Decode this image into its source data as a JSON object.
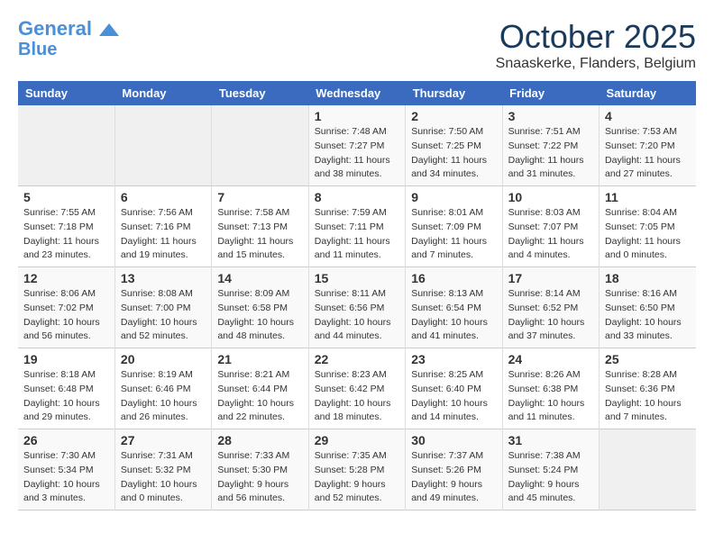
{
  "header": {
    "logo_line1": "General",
    "logo_line2": "Blue",
    "month": "October 2025",
    "location": "Snaaskerke, Flanders, Belgium"
  },
  "days_of_week": [
    "Sunday",
    "Monday",
    "Tuesday",
    "Wednesday",
    "Thursday",
    "Friday",
    "Saturday"
  ],
  "weeks": [
    [
      {
        "day": "",
        "info": ""
      },
      {
        "day": "",
        "info": ""
      },
      {
        "day": "",
        "info": ""
      },
      {
        "day": "1",
        "info": "Sunrise: 7:48 AM\nSunset: 7:27 PM\nDaylight: 11 hours\nand 38 minutes."
      },
      {
        "day": "2",
        "info": "Sunrise: 7:50 AM\nSunset: 7:25 PM\nDaylight: 11 hours\nand 34 minutes."
      },
      {
        "day": "3",
        "info": "Sunrise: 7:51 AM\nSunset: 7:22 PM\nDaylight: 11 hours\nand 31 minutes."
      },
      {
        "day": "4",
        "info": "Sunrise: 7:53 AM\nSunset: 7:20 PM\nDaylight: 11 hours\nand 27 minutes."
      }
    ],
    [
      {
        "day": "5",
        "info": "Sunrise: 7:55 AM\nSunset: 7:18 PM\nDaylight: 11 hours\nand 23 minutes."
      },
      {
        "day": "6",
        "info": "Sunrise: 7:56 AM\nSunset: 7:16 PM\nDaylight: 11 hours\nand 19 minutes."
      },
      {
        "day": "7",
        "info": "Sunrise: 7:58 AM\nSunset: 7:13 PM\nDaylight: 11 hours\nand 15 minutes."
      },
      {
        "day": "8",
        "info": "Sunrise: 7:59 AM\nSunset: 7:11 PM\nDaylight: 11 hours\nand 11 minutes."
      },
      {
        "day": "9",
        "info": "Sunrise: 8:01 AM\nSunset: 7:09 PM\nDaylight: 11 hours\nand 7 minutes."
      },
      {
        "day": "10",
        "info": "Sunrise: 8:03 AM\nSunset: 7:07 PM\nDaylight: 11 hours\nand 4 minutes."
      },
      {
        "day": "11",
        "info": "Sunrise: 8:04 AM\nSunset: 7:05 PM\nDaylight: 11 hours\nand 0 minutes."
      }
    ],
    [
      {
        "day": "12",
        "info": "Sunrise: 8:06 AM\nSunset: 7:02 PM\nDaylight: 10 hours\nand 56 minutes."
      },
      {
        "day": "13",
        "info": "Sunrise: 8:08 AM\nSunset: 7:00 PM\nDaylight: 10 hours\nand 52 minutes."
      },
      {
        "day": "14",
        "info": "Sunrise: 8:09 AM\nSunset: 6:58 PM\nDaylight: 10 hours\nand 48 minutes."
      },
      {
        "day": "15",
        "info": "Sunrise: 8:11 AM\nSunset: 6:56 PM\nDaylight: 10 hours\nand 44 minutes."
      },
      {
        "day": "16",
        "info": "Sunrise: 8:13 AM\nSunset: 6:54 PM\nDaylight: 10 hours\nand 41 minutes."
      },
      {
        "day": "17",
        "info": "Sunrise: 8:14 AM\nSunset: 6:52 PM\nDaylight: 10 hours\nand 37 minutes."
      },
      {
        "day": "18",
        "info": "Sunrise: 8:16 AM\nSunset: 6:50 PM\nDaylight: 10 hours\nand 33 minutes."
      }
    ],
    [
      {
        "day": "19",
        "info": "Sunrise: 8:18 AM\nSunset: 6:48 PM\nDaylight: 10 hours\nand 29 minutes."
      },
      {
        "day": "20",
        "info": "Sunrise: 8:19 AM\nSunset: 6:46 PM\nDaylight: 10 hours\nand 26 minutes."
      },
      {
        "day": "21",
        "info": "Sunrise: 8:21 AM\nSunset: 6:44 PM\nDaylight: 10 hours\nand 22 minutes."
      },
      {
        "day": "22",
        "info": "Sunrise: 8:23 AM\nSunset: 6:42 PM\nDaylight: 10 hours\nand 18 minutes."
      },
      {
        "day": "23",
        "info": "Sunrise: 8:25 AM\nSunset: 6:40 PM\nDaylight: 10 hours\nand 14 minutes."
      },
      {
        "day": "24",
        "info": "Sunrise: 8:26 AM\nSunset: 6:38 PM\nDaylight: 10 hours\nand 11 minutes."
      },
      {
        "day": "25",
        "info": "Sunrise: 8:28 AM\nSunset: 6:36 PM\nDaylight: 10 hours\nand 7 minutes."
      }
    ],
    [
      {
        "day": "26",
        "info": "Sunrise: 7:30 AM\nSunset: 5:34 PM\nDaylight: 10 hours\nand 3 minutes."
      },
      {
        "day": "27",
        "info": "Sunrise: 7:31 AM\nSunset: 5:32 PM\nDaylight: 10 hours\nand 0 minutes."
      },
      {
        "day": "28",
        "info": "Sunrise: 7:33 AM\nSunset: 5:30 PM\nDaylight: 9 hours\nand 56 minutes."
      },
      {
        "day": "29",
        "info": "Sunrise: 7:35 AM\nSunset: 5:28 PM\nDaylight: 9 hours\nand 52 minutes."
      },
      {
        "day": "30",
        "info": "Sunrise: 7:37 AM\nSunset: 5:26 PM\nDaylight: 9 hours\nand 49 minutes."
      },
      {
        "day": "31",
        "info": "Sunrise: 7:38 AM\nSunset: 5:24 PM\nDaylight: 9 hours\nand 45 minutes."
      },
      {
        "day": "",
        "info": ""
      }
    ]
  ]
}
